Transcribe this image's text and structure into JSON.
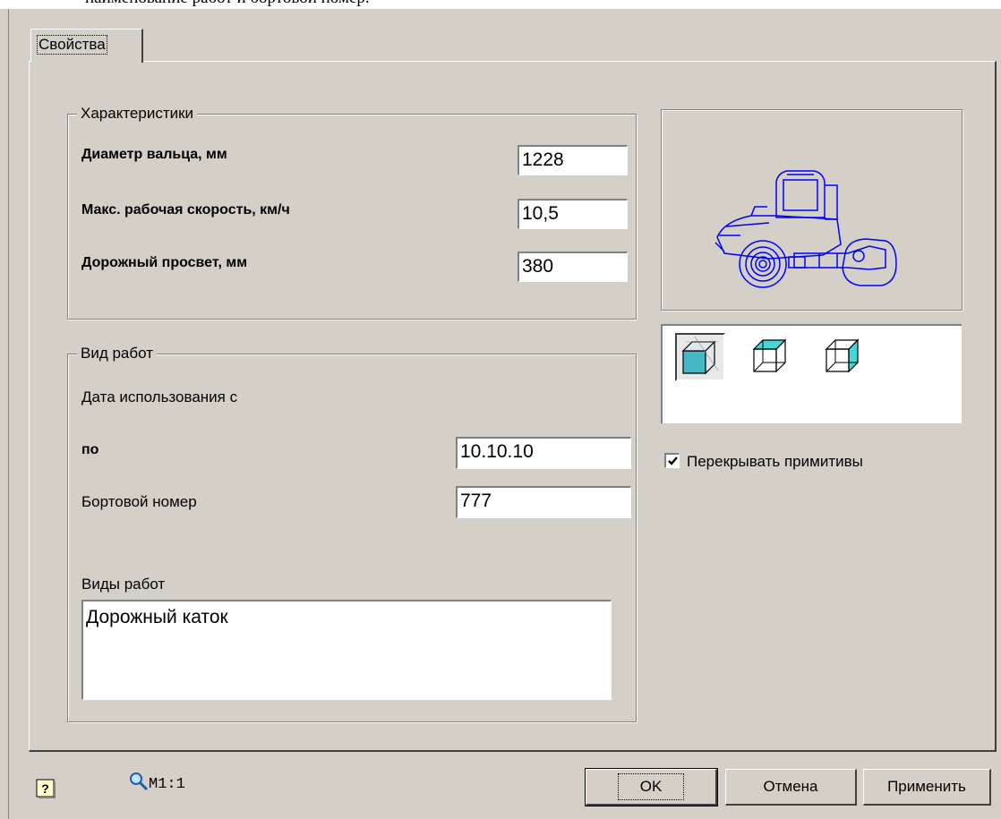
{
  "header_text": "наименование работ и бортовой номер.",
  "tab": {
    "label": "Свойства"
  },
  "characteristics": {
    "legend": "Характеристики",
    "fields": [
      {
        "label": "Диаметр вальца, мм",
        "value": "1228"
      },
      {
        "label": "Макс. рабочая скорость, км/ч",
        "value": "10,5"
      },
      {
        "label": "Дорожный просвет, мм",
        "value": "380"
      }
    ]
  },
  "work": {
    "legend": "Вид работ",
    "date_from_label": "Дата использования с",
    "date_to_label": "по",
    "date_to_value": "10.10.10",
    "board_number_label": "Бортовой номер",
    "board_number_value": "777",
    "work_types_label": "Виды работ",
    "work_types_value": "Дорожный каток"
  },
  "preview": {
    "icon": "road-roller-icon",
    "line_color": "#0000ff"
  },
  "view_modes": [
    {
      "icon": "cube-solid-icon",
      "selected": true
    },
    {
      "icon": "cube-face-icon",
      "selected": false
    },
    {
      "icon": "cube-side-icon",
      "selected": false
    }
  ],
  "overlap_checkbox": {
    "label": "Перекрывать примитивы",
    "checked": true
  },
  "footer": {
    "zoom_label": "M1:1",
    "ok": "OK",
    "cancel": "Отмена",
    "apply": "Применить"
  },
  "colors": {
    "face": "#d4d0c8",
    "cube_fill": "#46b8c8"
  }
}
